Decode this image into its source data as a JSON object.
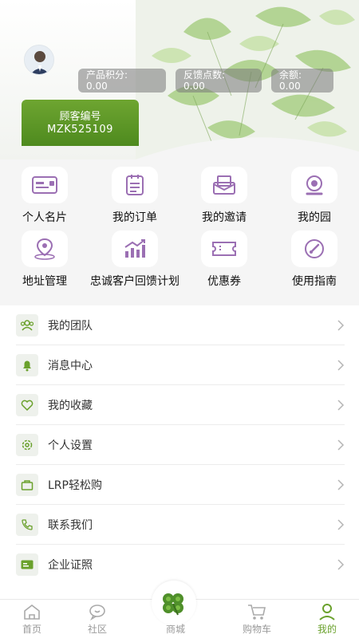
{
  "header": {
    "stats": [
      {
        "label": "产品积分:",
        "value": "0.00"
      },
      {
        "label": "反馈点数:",
        "value": "0.00"
      },
      {
        "label": "余额:",
        "value": "0.00"
      }
    ],
    "member": {
      "label": "顾客编号",
      "id": "MZK525109"
    }
  },
  "grid": [
    {
      "label": "个人名片",
      "icon": "card-icon"
    },
    {
      "label": "我的订单",
      "icon": "order-list-icon"
    },
    {
      "label": "我的邀请",
      "icon": "invite-mail-icon"
    },
    {
      "label": "我的园",
      "icon": "garden-icon"
    },
    {
      "label": "地址管理",
      "icon": "location-pin-icon"
    },
    {
      "label": "忠诚客户回馈计划",
      "icon": "growth-chart-icon"
    },
    {
      "label": "优惠券",
      "icon": "coupon-icon"
    },
    {
      "label": "使用指南",
      "icon": "guide-compass-icon"
    }
  ],
  "list": [
    {
      "label": "我的团队",
      "icon": "team-icon"
    },
    {
      "label": "消息中心",
      "icon": "bell-icon"
    },
    {
      "label": "我的收藏",
      "icon": "heart-icon"
    },
    {
      "label": "个人设置",
      "icon": "settings-gear-icon"
    },
    {
      "label": "LRP轻松购",
      "icon": "bag-icon"
    },
    {
      "label": "联系我们",
      "icon": "phone-icon"
    },
    {
      "label": "企业证照",
      "icon": "license-icon"
    }
  ],
  "tabs": [
    {
      "label": "首页",
      "icon": "home-icon"
    },
    {
      "label": "社区",
      "icon": "community-chat-icon"
    },
    {
      "label": "商城",
      "icon": "clover-icon"
    },
    {
      "label": "购物车",
      "icon": "cart-icon"
    },
    {
      "label": "我的",
      "icon": "profile-icon"
    }
  ],
  "colors": {
    "accent": "#6aa12c",
    "icon_purple": "#9b6fb3",
    "list_icon_green": "#6aa12c"
  }
}
